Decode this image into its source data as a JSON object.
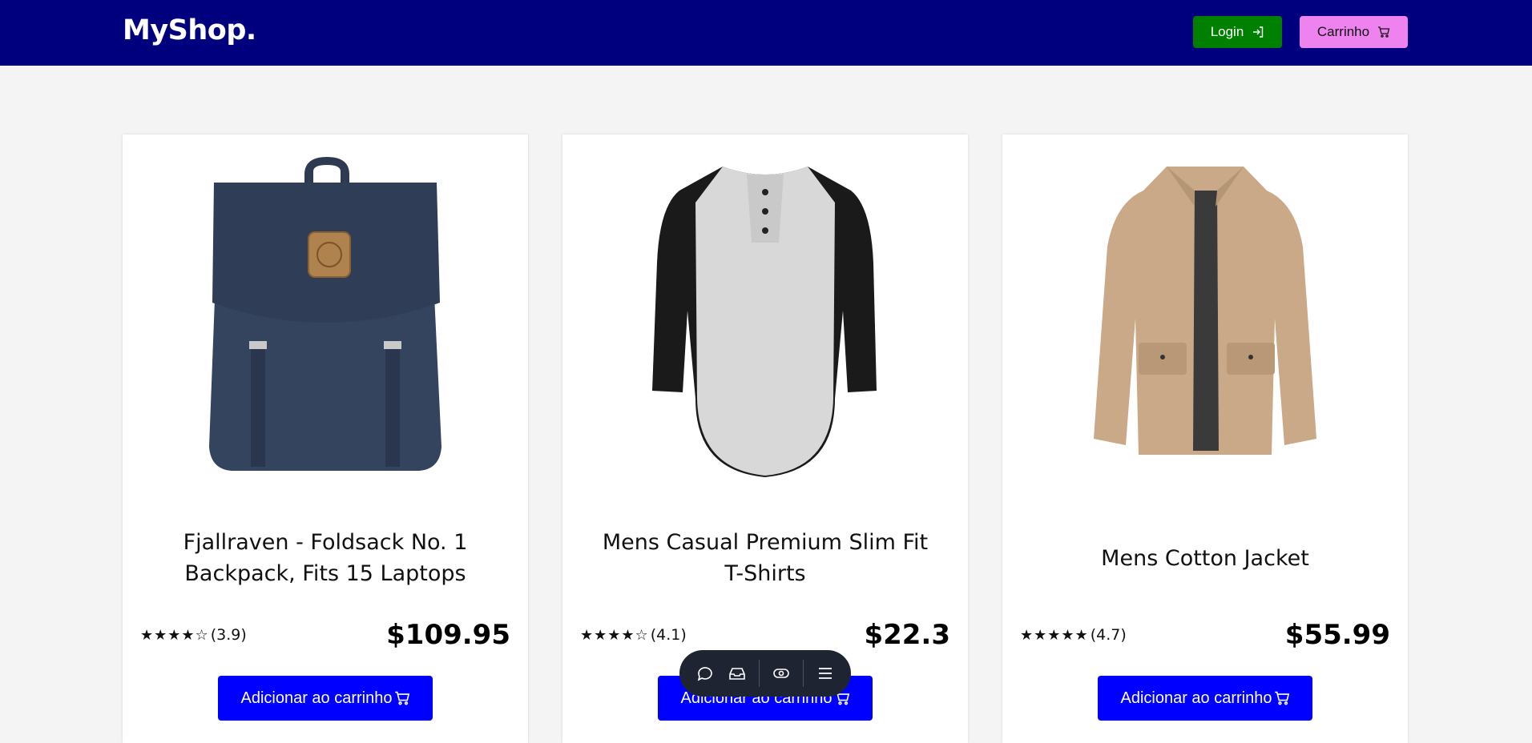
{
  "header": {
    "logo": "MyShop.",
    "login_label": "Login",
    "cart_label": "Carrinho",
    "colors": {
      "bar": "#00007f",
      "login": "#008000",
      "cart": "#ee82ee"
    }
  },
  "products": [
    {
      "title": "Fjallraven - Foldsack No. 1 Backpack, Fits 15 Laptops",
      "stars": "★★★★☆",
      "rating": "(3.9)",
      "price": "$109.95",
      "button": "Adicionar ao carrinho",
      "image": "backpack-image"
    },
    {
      "title": "Mens Casual Premium Slim Fit T-Shirts",
      "stars": "★★★★☆",
      "rating": "(4.1)",
      "price": "$22.3",
      "button": "Adicionar ao carrinho",
      "image": "tshirt-image"
    },
    {
      "title": "Mens Cotton Jacket",
      "stars": "★★★★★",
      "rating": "(4.7)",
      "price": "$55.99",
      "button": "Adicionar ao carrinho",
      "image": "jacket-image"
    }
  ],
  "floating_toolbar": {
    "icons": [
      "chat-icon",
      "inbox-icon",
      "eye-icon",
      "menu-icon"
    ]
  }
}
